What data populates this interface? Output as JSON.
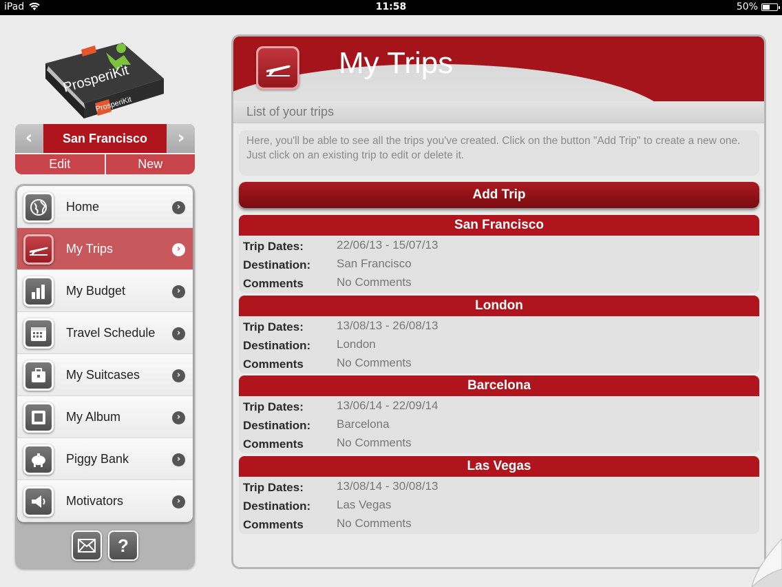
{
  "status_bar": {
    "device": "iPad",
    "time": "11:58",
    "battery": "50%",
    "battery_level": 0.5
  },
  "logo": {
    "brand": "ProsperiKit",
    "label": "ProsperiKit"
  },
  "trip_selector": {
    "current": "San Francisco",
    "edit_label": "Edit",
    "new_label": "New"
  },
  "nav": {
    "items": [
      {
        "label": "Home",
        "icon": "globe-icon"
      },
      {
        "label": "My Trips",
        "icon": "airplane-icon"
      },
      {
        "label": "My Budget",
        "icon": "bar-chart-icon"
      },
      {
        "label": "Travel Schedule",
        "icon": "calendar-icon"
      },
      {
        "label": "My Suitcases",
        "icon": "suitcase-icon"
      },
      {
        "label": "My Album",
        "icon": "album-icon"
      },
      {
        "label": "Piggy Bank",
        "icon": "piggy-bank-icon"
      },
      {
        "label": "Motivators",
        "icon": "megaphone-icon"
      }
    ],
    "active": "My Trips",
    "footer": {
      "mail_icon": "mail-icon",
      "help_label": "?"
    }
  },
  "main": {
    "title": "My Trips",
    "subtitle": "List of your trips",
    "description": "Here, you'll be able to see all the trips you've created. Click on the button \"Add Trip\" to create a new one. Just click on an existing trip to edit or delete it.",
    "add_button": "Add Trip",
    "field_labels": {
      "dates": "Trip Dates:",
      "destination": "Destination:",
      "comments": "Comments"
    },
    "trips": [
      {
        "name": "San Francisco",
        "dates": "22/06/13 - 15/07/13",
        "destination": "San Francisco",
        "comments": "No Comments"
      },
      {
        "name": "London",
        "dates": "13/08/13 - 26/08/13",
        "destination": "London",
        "comments": "No Comments"
      },
      {
        "name": "Barcelona",
        "dates": "13/06/14 - 22/09/14",
        "destination": "Barcelona",
        "comments": "No Comments"
      },
      {
        "name": "Las Vegas",
        "dates": "13/08/14 - 30/08/13",
        "destination": "Las Vegas",
        "comments": "No Comments"
      }
    ]
  },
  "colors": {
    "brand_red": "#b0141c",
    "dark_red": "#7a0c10",
    "active_nav": "#c8585c",
    "panel_gray": "#b4b4b4"
  }
}
